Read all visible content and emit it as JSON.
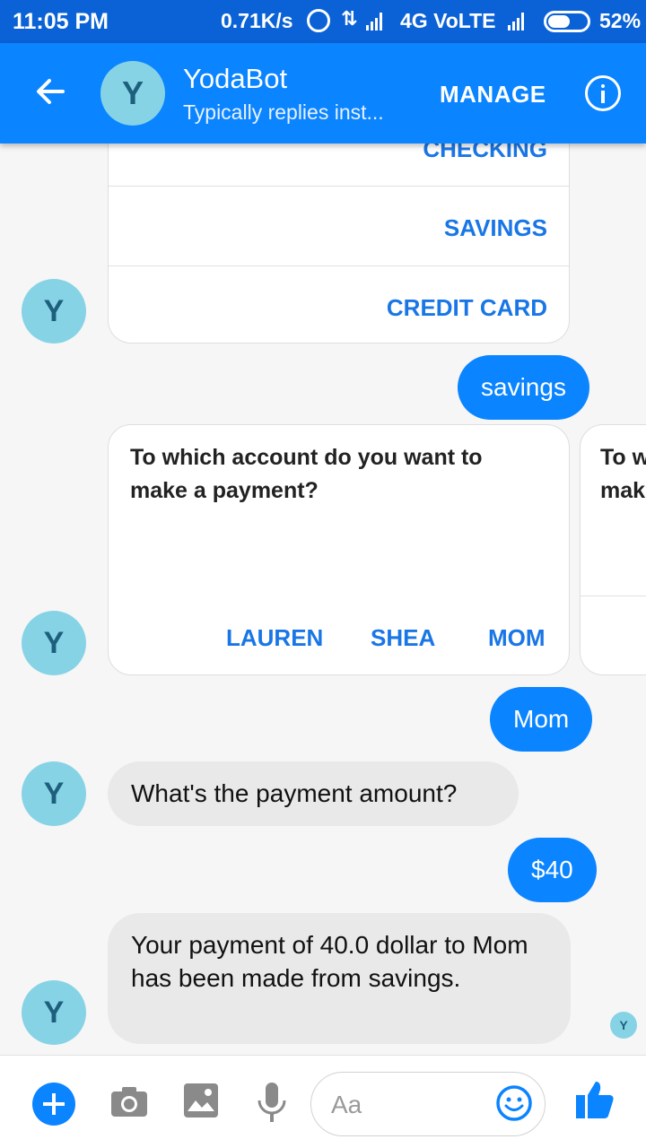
{
  "status_bar": {
    "time": "11:05 PM",
    "speed": "0.71K/s",
    "network": "4G VoLTE",
    "battery": "52%"
  },
  "header": {
    "avatar_letter": "Y",
    "title": "YodaBot",
    "subtitle": "Typically replies inst...",
    "manage_label": "MANAGE"
  },
  "messages": {
    "account_card": {
      "options": [
        "CHECKING",
        "SAVINGS",
        "CREDIT CARD"
      ]
    },
    "user_reply_1": "savings",
    "payment_card": {
      "question": "To which account do you want to make a payment?",
      "choices": [
        "LAUREN",
        "SHEA",
        "MOM"
      ],
      "peek_text_line1": "To w",
      "peek_text_line2": "mak"
    },
    "user_reply_2": "Mom",
    "bot_prompt": "What's the payment amount?",
    "user_reply_3": "$40",
    "bot_confirm": "Your payment of 40.0 dollar to Mom has been made from savings."
  },
  "avatar_letter": "Y",
  "seen_letter": "Y",
  "composer": {
    "placeholder": "Aa"
  },
  "colors": {
    "status_bar": "#0a62d6",
    "app_bar": "#0a84ff",
    "accent": "#1976e6",
    "avatar_bg": "#87d3e6",
    "incoming_bubble": "#e9e9e9"
  }
}
